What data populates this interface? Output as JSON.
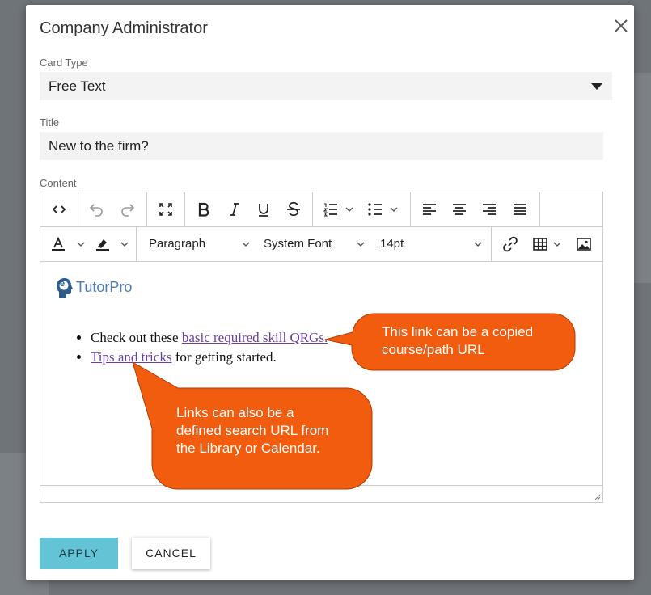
{
  "dialog": {
    "title": "Company Administrator",
    "card_type": {
      "label": "Card Type",
      "value": "Free Text"
    },
    "title_field": {
      "label": "Title",
      "value": "New to the firm?"
    },
    "content_label": "Content"
  },
  "editor": {
    "block_format": "Paragraph",
    "font_family": "System Font",
    "font_size": "14pt",
    "logo_text": "TutorPro",
    "logo_badge": "e",
    "bullets": [
      {
        "before": "Check out these ",
        "link": "basic required skill QRGs.",
        "after": ""
      },
      {
        "before": "",
        "link": "Tips and tricks",
        "after": " for getting started."
      }
    ]
  },
  "buttons": {
    "apply": "APPLY",
    "cancel": "CANCEL"
  },
  "callouts": [
    {
      "text": "This link can be a copied course/path URL"
    },
    {
      "text": "Links can also be a defined search URL from the Library or Calendar."
    }
  ],
  "colors": {
    "callout_fill": "#f25c0f",
    "apply_button": "#63c4d5",
    "link": "#6a3fa0",
    "logo": "#4a7db5"
  }
}
